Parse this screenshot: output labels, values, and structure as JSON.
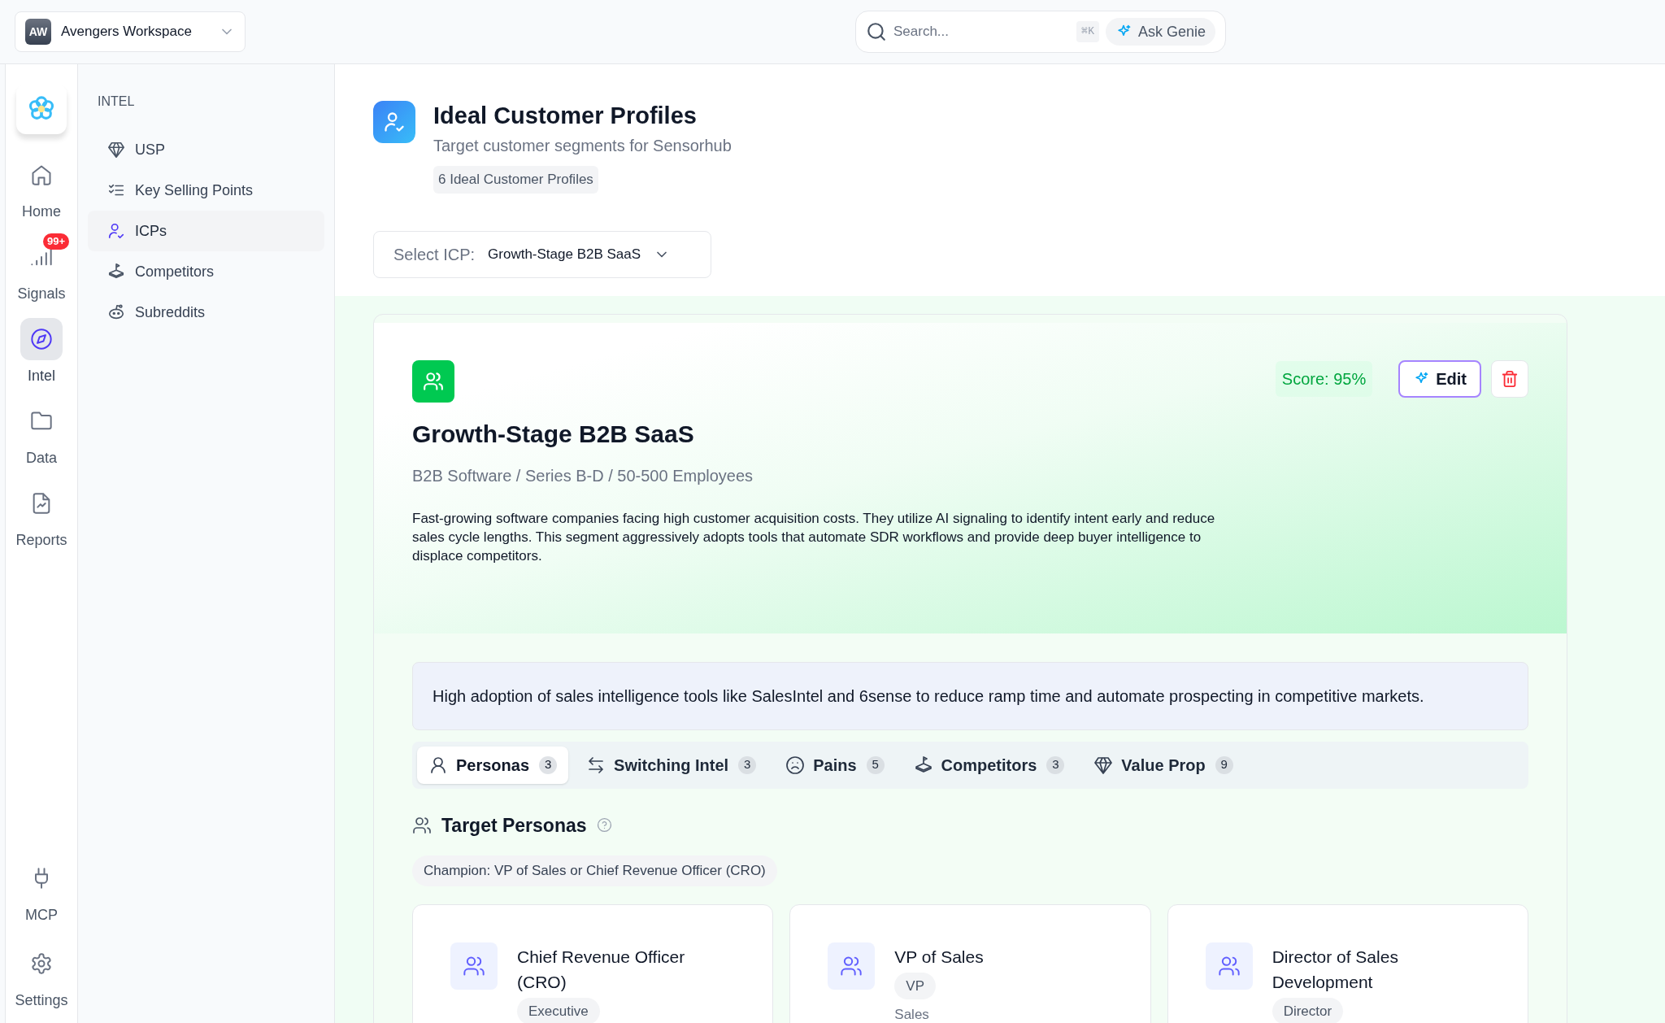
{
  "workspace": {
    "initials": "AW",
    "name": "Avengers Workspace"
  },
  "search": {
    "placeholder": "Search...",
    "shortcut": "⌘K",
    "ask_label": "Ask Genie"
  },
  "rail": {
    "items": [
      {
        "label": "Home",
        "selected": false
      },
      {
        "label": "Signals",
        "selected": false,
        "badge": "99+"
      },
      {
        "label": "Intel",
        "selected": true
      },
      {
        "label": "Data",
        "selected": false
      },
      {
        "label": "Reports",
        "selected": false
      }
    ],
    "footer_items": [
      {
        "label": "MCP",
        "selected": false
      },
      {
        "label": "Settings",
        "selected": false
      }
    ]
  },
  "section_nav": {
    "heading": "INTEL",
    "items": [
      {
        "label": "USP",
        "selected": false
      },
      {
        "label": "Key Selling Points",
        "selected": false
      },
      {
        "label": "ICPs",
        "selected": true
      },
      {
        "label": "Competitors",
        "selected": false
      },
      {
        "label": "Subreddits",
        "selected": false
      }
    ]
  },
  "header": {
    "title": "Ideal Customer Profiles",
    "subtitle": "Target customer segments for Sensorhub",
    "count_badge": "6 Ideal Customer Profiles"
  },
  "select": {
    "label": "Select ICP:",
    "value": "Growth-Stage B2B SaaS"
  },
  "icp": {
    "title": "Growth-Stage B2B SaaS",
    "subtitle": "B2B Software / Series B-D / 50-500 Employees",
    "score": "Score: 95%",
    "edit_label": "Edit",
    "description": "Fast-growing software companies facing high customer acquisition costs. They utilize AI signaling to identify intent early and reduce sales cycle lengths. This segment aggressively adopts tools that automate SDR workflows and provide deep buyer intelligence to displace competitors.",
    "insight": "High adoption of sales intelligence tools like SalesIntel and 6sense to reduce ramp time and automate prospecting in competitive markets."
  },
  "tabs": [
    {
      "label": "Personas",
      "count": "3",
      "selected": true
    },
    {
      "label": "Switching Intel",
      "count": "3",
      "selected": false
    },
    {
      "label": "Pains",
      "count": "5",
      "selected": false
    },
    {
      "label": "Competitors",
      "count": "3",
      "selected": false
    },
    {
      "label": "Value Prop",
      "count": "9",
      "selected": false
    }
  ],
  "personas": {
    "heading": "Target Personas",
    "champion": "Champion: VP of Sales or Chief Revenue Officer (CRO)",
    "cards": [
      {
        "title": "Chief Revenue Officer (CRO)",
        "tag": "Executive"
      },
      {
        "title": "VP of Sales",
        "tag": "VP",
        "department": "Sales"
      },
      {
        "title": "Director of Sales Development",
        "tag": "Director"
      }
    ]
  }
}
